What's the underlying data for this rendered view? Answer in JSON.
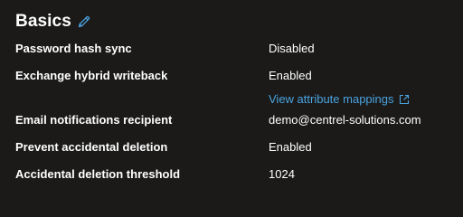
{
  "section": {
    "title": "Basics",
    "edit_icon": "pencil-icon"
  },
  "rows": [
    {
      "label": "Password hash sync",
      "value": "Disabled"
    },
    {
      "label": "Exchange hybrid writeback",
      "value": "Enabled"
    },
    {
      "label": "Email notifications recipient",
      "value": "demo@centrel-solutions.com"
    },
    {
      "label": "Prevent accidental deletion",
      "value": "Enabled"
    },
    {
      "label": "Accidental deletion threshold",
      "value": "1024"
    }
  ],
  "link": {
    "label": "View attribute mappings",
    "icon": "external-link-icon"
  },
  "colors": {
    "background": "#1b1a19",
    "text": "#ffffff",
    "link": "#4aa3df"
  }
}
